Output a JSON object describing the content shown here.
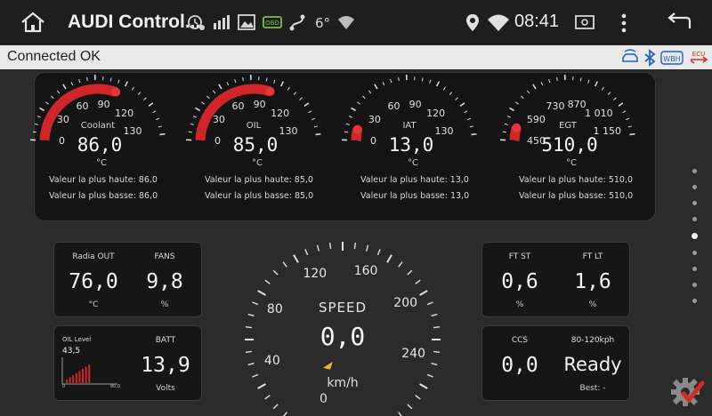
{
  "statusbar": {
    "title": "AUDI Control...",
    "time": "08:41",
    "icons": [
      "home-icon",
      "audio-settings-icon",
      "signal-bars-icon",
      "image-icon",
      "obd-icon",
      "route-icon",
      "temperature-icon",
      "wifi-network-icon",
      "location-icon",
      "wifi-icon",
      "sd-card-icon",
      "more-vert-icon",
      "back-icon"
    ]
  },
  "connection": {
    "status": "Connected OK",
    "icons": [
      "car-wifi-icon",
      "bluetooth-icon",
      "wbh-adapter-icon",
      "ecu-icon"
    ]
  },
  "gauges": [
    {
      "name": "Coolant",
      "value": "86,0",
      "unit": "°C",
      "ticks": [
        "0",
        "30",
        "60",
        "90",
        "120",
        "130"
      ],
      "max_label": "Valeur la plus haute:",
      "max_value": "86,0",
      "min_label": "Valeur la plus basse:",
      "min_value": "86,0",
      "fill": 0.63,
      "accent": "#d0262a"
    },
    {
      "name": "OIL",
      "value": "85,0",
      "unit": "°C",
      "ticks": [
        "0",
        "30",
        "60",
        "90",
        "120",
        "130"
      ],
      "max_label": "Valeur la plus haute:",
      "max_value": "85,0",
      "min_label": "Valeur la plus basse:",
      "min_value": "85,0",
      "fill": 0.62,
      "accent": "#d0262a"
    },
    {
      "name": "IAT",
      "value": "13,0",
      "unit": "°C",
      "ticks": [
        "0",
        "30",
        "60",
        "90",
        "120",
        "130"
      ],
      "max_label": "Valeur la plus haute:",
      "max_value": "13,0",
      "min_label": "Valeur la plus basse:",
      "min_value": "13,0",
      "fill": 0.07,
      "accent": "#d0262a"
    },
    {
      "name": "EGT",
      "value": "510,0",
      "unit": "°C",
      "ticks": [
        "450",
        "590",
        "730",
        "870",
        "1 010",
        "1 150"
      ],
      "max_label": "Valeur la plus haute:",
      "max_value": "510,0",
      "min_label": "Valeur la plus basse:",
      "min_value": "510,0",
      "fill": 0.08,
      "accent": "#d0262a"
    }
  ],
  "radia_fans": {
    "radia_label": "Radia OUT",
    "radia_value": "76,0",
    "radia_unit": "°C",
    "fans_label": "FANS",
    "fans_value": "9,8",
    "fans_unit": "%"
  },
  "oil_batt": {
    "oil_label": "OIL Level",
    "oil_value": "43,5",
    "bar_min": "0",
    "bar_max": "80,0",
    "oil_level_fraction": 0.54,
    "batt_label": "BATT",
    "batt_value": "13,9",
    "batt_unit": "Volts"
  },
  "speedometer": {
    "label": "SPEED",
    "value": "0,0",
    "unit": "km/h",
    "ticks": [
      "0",
      "40",
      "80",
      "120",
      "160",
      "200",
      "240"
    ]
  },
  "ft": {
    "st_label": "FT ST",
    "st_value": "0,6",
    "st_unit": "%",
    "lt_label": "FT LT",
    "lt_value": "1,6",
    "lt_unit": "%"
  },
  "ccs": {
    "ccs_label": "CCS",
    "ccs_value": "0,0",
    "kph_label": "80-120kph",
    "kph_value": "Ready",
    "kph_sub": "Best: -"
  },
  "pager": {
    "count": 9,
    "active": 4
  },
  "colors": {
    "accent": "#d0262a",
    "speed_needle": "#f2b31c",
    "badge": "#d62a2a"
  }
}
